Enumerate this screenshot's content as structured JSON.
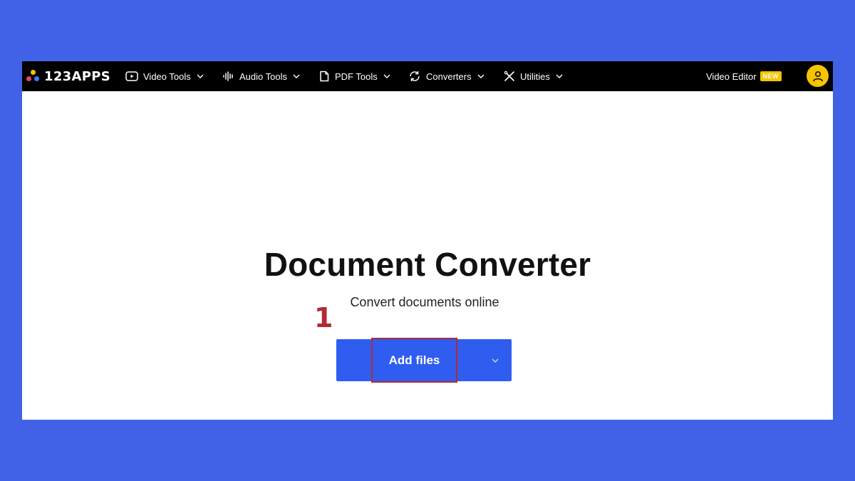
{
  "brand": {
    "name": "123APPS",
    "dot_colors": [
      "#f5c400",
      "#e8465a",
      "#3a7bff"
    ]
  },
  "nav": {
    "items": [
      {
        "label": "Video Tools",
        "icon": "video-icon"
      },
      {
        "label": "Audio Tools",
        "icon": "audio-wave-icon"
      },
      {
        "label": "PDF Tools",
        "icon": "pdf-icon"
      },
      {
        "label": "Converters",
        "icon": "converter-icon"
      },
      {
        "label": "Utilities",
        "icon": "utilities-icon"
      }
    ],
    "video_editor_label": "Video Editor",
    "new_badge": "NEW"
  },
  "main": {
    "title": "Document Converter",
    "subtitle": "Convert documents online",
    "step_marker": "1",
    "add_files_label": "Add files"
  },
  "colors": {
    "page_background": "#4162e6",
    "navbar": "#000000",
    "accent_yellow": "#f5c400",
    "button_blue": "#2f5df0",
    "highlight_red": "#b12a34"
  }
}
